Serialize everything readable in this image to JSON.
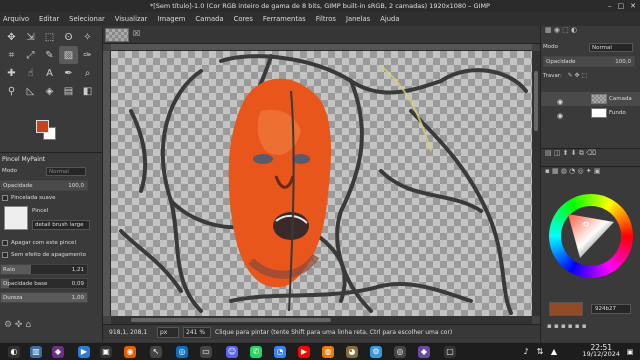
{
  "window": {
    "title": "*[Sem título]-1.0 (Cor RGB inteiro de gama de 8 bits, GIMP built-in sRGB, 2 camadas) 1920x1080 – GIMP"
  },
  "menu": [
    "Arquivo",
    "Editar",
    "Selecionar",
    "Visualizar",
    "Imagem",
    "Camada",
    "Cores",
    "Ferramentas",
    "Filtros",
    "Janelas",
    "Ajuda"
  ],
  "toolbox": {
    "tools": [
      "move-icon",
      "align-icon",
      "rect-select-icon",
      "free-select-icon",
      "fuzzy-select-icon",
      "crop-icon",
      "warp-icon",
      "paint-icon",
      "mypaint-brush-icon",
      "clone-icon",
      "heal-icon",
      "smudge-icon",
      "text-icon",
      "path-icon",
      "color-picker-icon",
      "zoom-icon",
      "measure-icon",
      "bucket-icon",
      "gradient-icon",
      "eraser-icon"
    ],
    "colors": {
      "foreground": "#c8421c",
      "background": "#ffffff"
    }
  },
  "tool_options": {
    "title": "Pincel MyPaint",
    "mode_label": "Modo",
    "mode_value": "Normal",
    "opacity_label": "Opacidade",
    "opacity_value": "100,0",
    "smooth_label": "Pincelada suave",
    "brush_label": "Pincel",
    "brush_name": "detail brush large",
    "erase_label": "Apagar com este pincel",
    "no_erase_label": "Sem efeito de apagamento",
    "radius_label": "Raio",
    "radius_value": "1,21",
    "base_opacity_label": "Opacidade base",
    "base_opacity_value": "0,09",
    "hardness_label": "Dureza",
    "hardness_value": "1,00"
  },
  "status": {
    "coords": "918,1, 208,1",
    "unit": "px",
    "zoom": "241 %",
    "hint": "Clique para pintar (tente Shift para uma linha reta, Ctrl para escolher uma cor)"
  },
  "layers_panel": {
    "mode_label": "Modo",
    "mode_value": "Normal",
    "opacity_label": "Opacidade",
    "opacity_value": "100,0",
    "lock_label": "Travar:",
    "layers": [
      {
        "name": "Camada",
        "visible": true
      },
      {
        "name": "Fundo",
        "visible": true
      }
    ]
  },
  "color_panel": {
    "hex": "924b27"
  },
  "clock": {
    "time": "22:51",
    "date": "19/12/2024"
  }
}
